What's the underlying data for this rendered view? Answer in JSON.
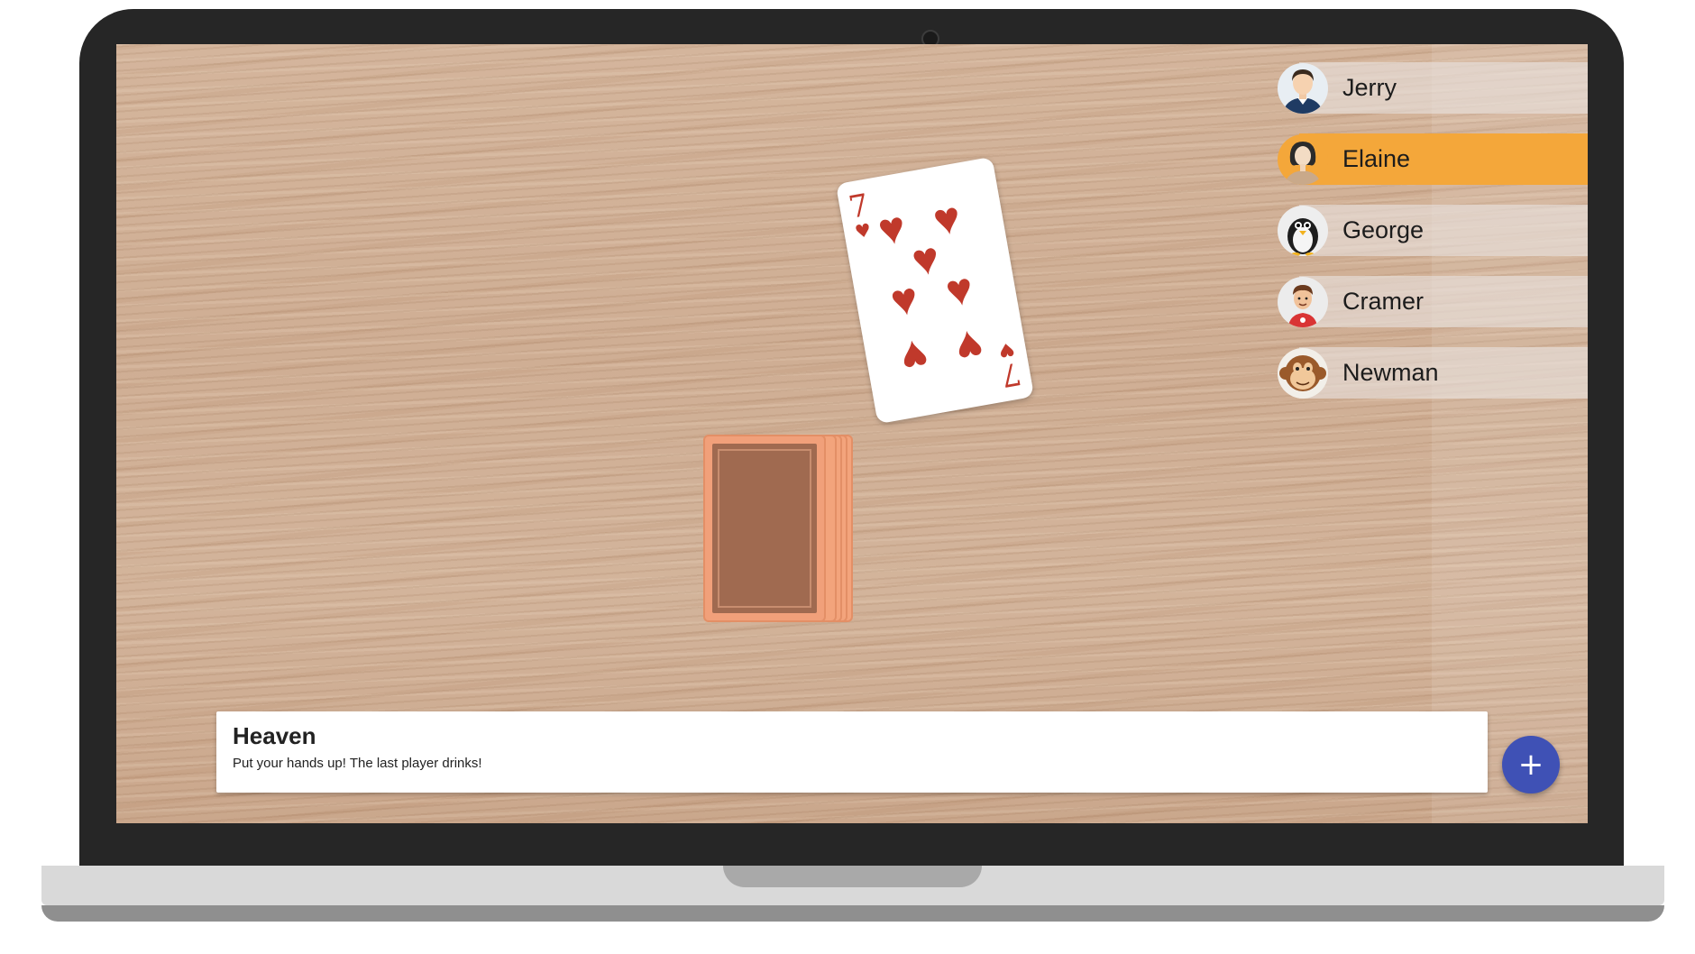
{
  "players": [
    {
      "name": "Jerry",
      "avatar": "man-avatar-icon",
      "active": false
    },
    {
      "name": "Elaine",
      "avatar": "woman-avatar-icon",
      "active": true
    },
    {
      "name": "George",
      "avatar": "penguin-avatar-icon",
      "active": false
    },
    {
      "name": "Cramer",
      "avatar": "boy-avatar-icon",
      "active": false
    },
    {
      "name": "Newman",
      "avatar": "monkey-avatar-icon",
      "active": false
    }
  ],
  "played_card": {
    "rank": "7",
    "suit": "♥",
    "suit_name": "hearts"
  },
  "rule": {
    "title": "Heaven",
    "text": "Put your hands up! The last player drinks!"
  },
  "fab": {
    "label": "+"
  },
  "colors": {
    "active_player": "#f4a73a",
    "fab": "#3f51b5",
    "card_suit": "#c0392b",
    "deck_back": "#a06a50"
  }
}
